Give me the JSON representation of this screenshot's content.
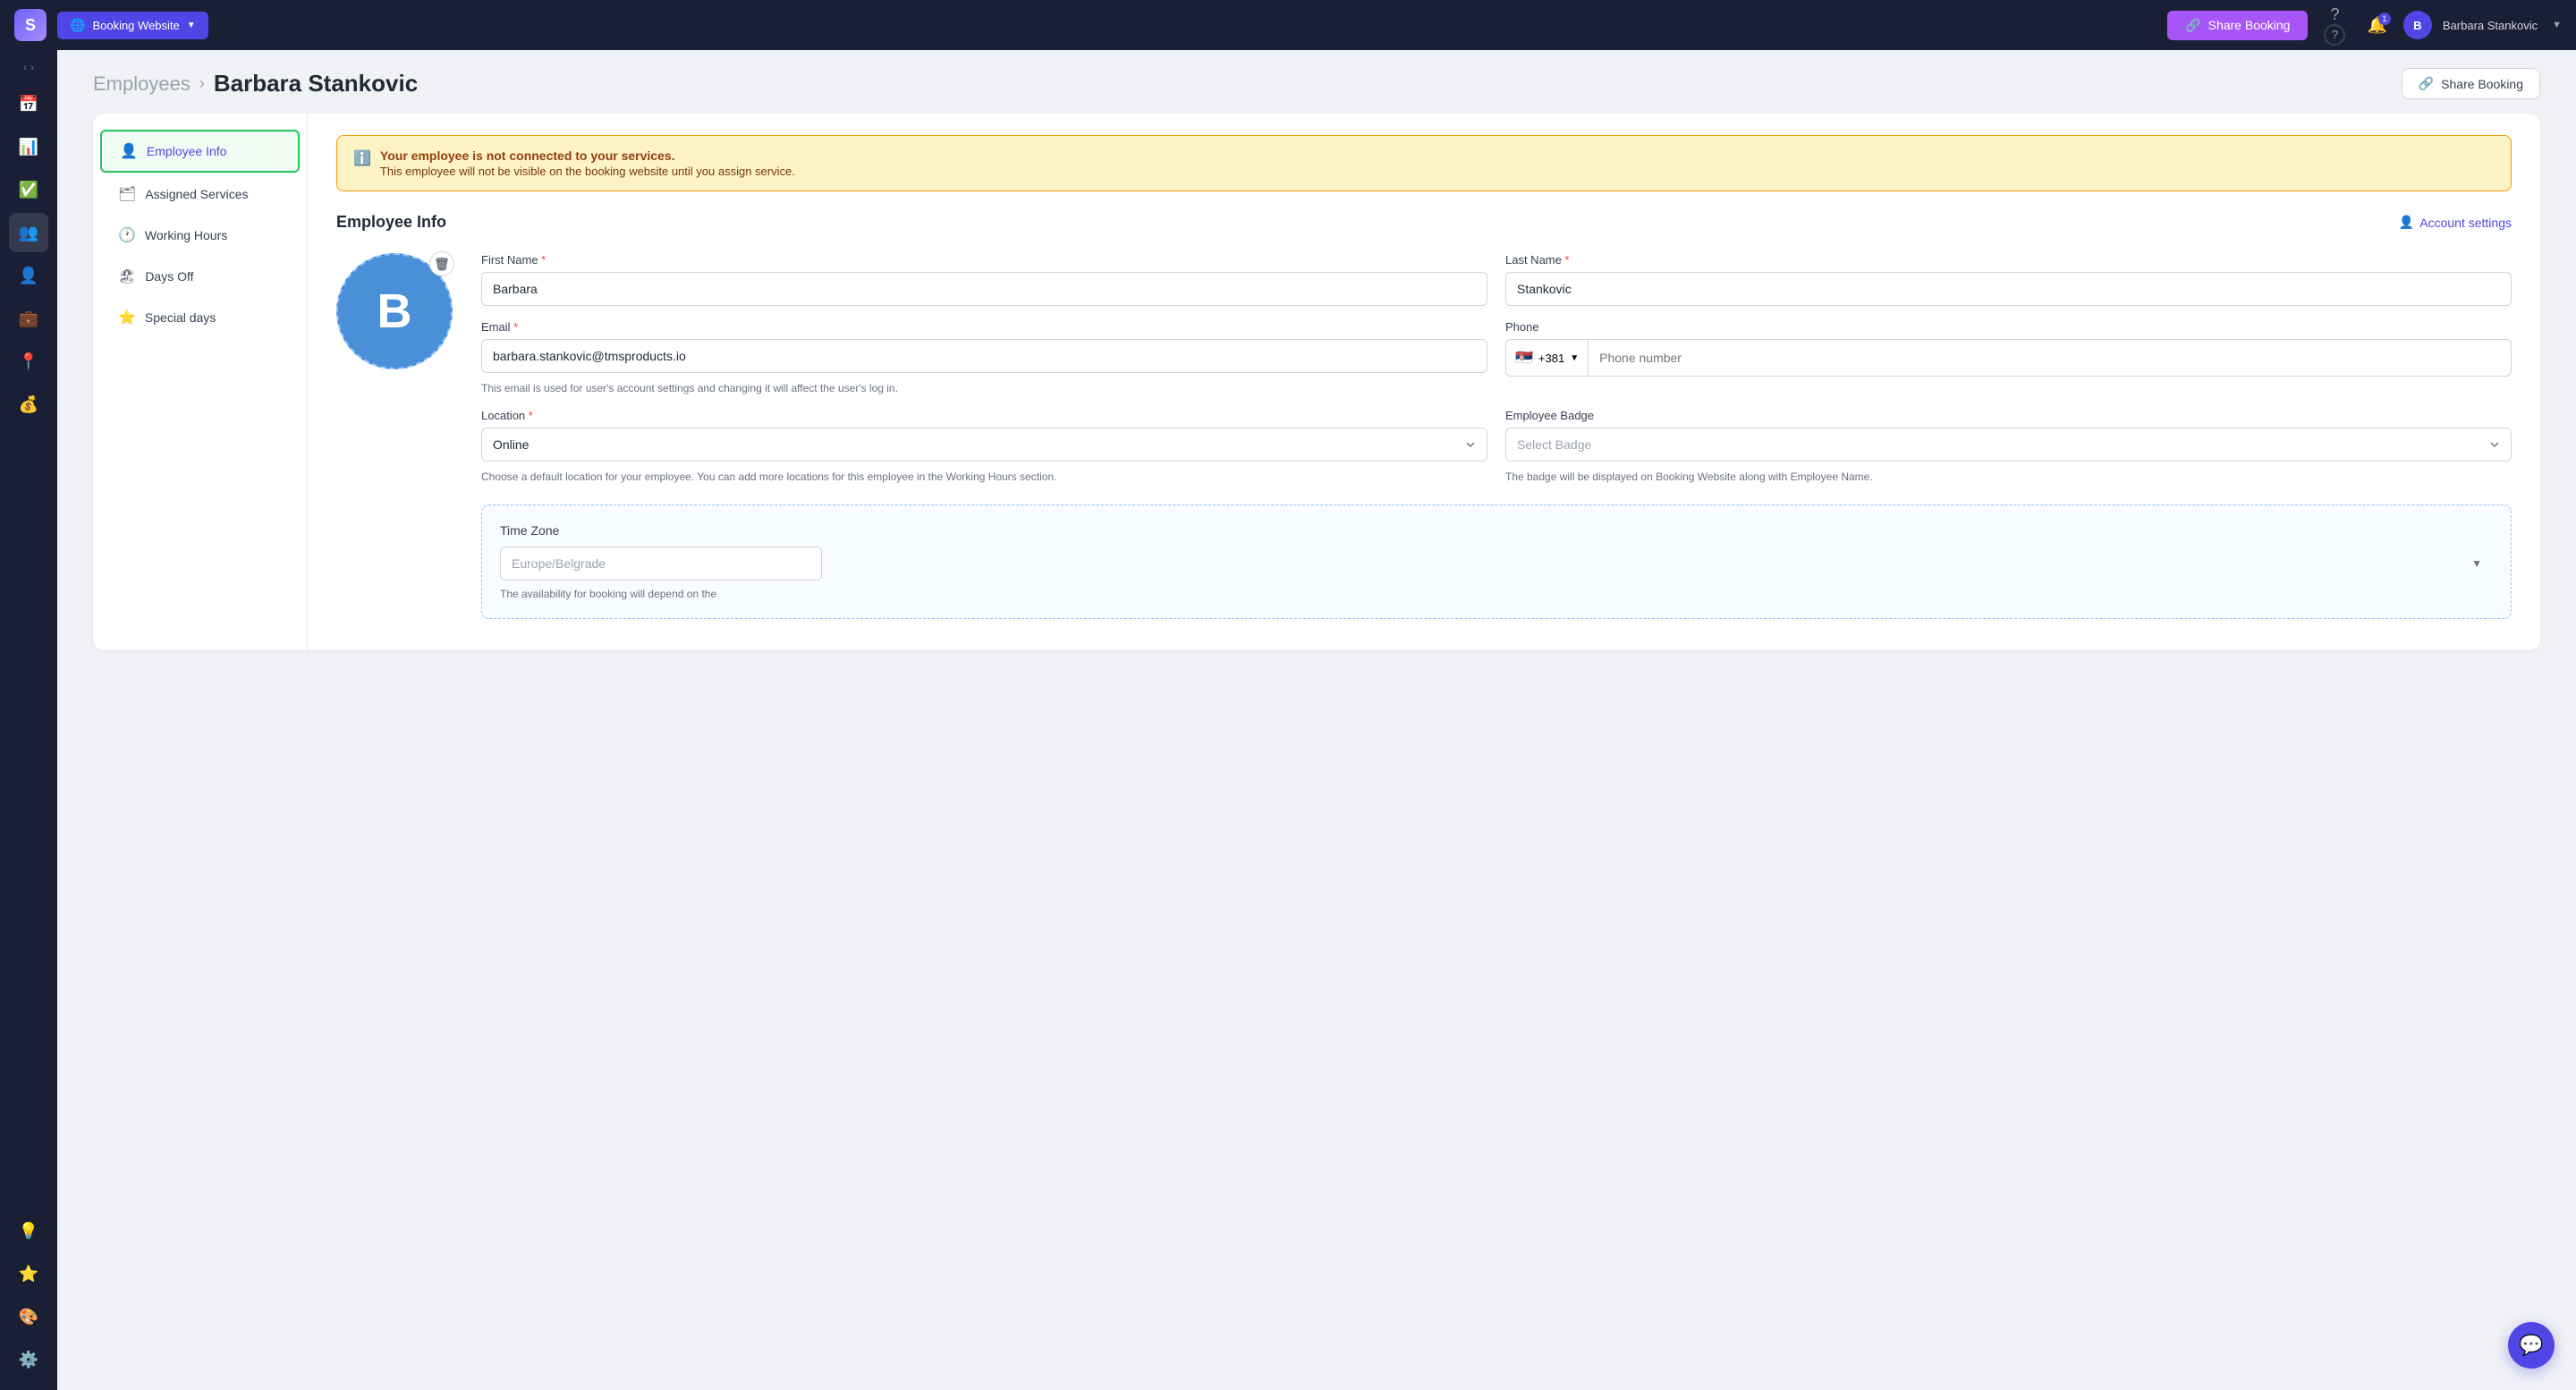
{
  "app": {
    "logo": "S",
    "nav": {
      "booking_website_label": "Booking Website",
      "share_booking_nav": "Share Booking",
      "user_initials": "B",
      "user_name": "Barbara Stankovic",
      "notification_count": "1"
    }
  },
  "breadcrumb": {
    "parent": "Employees",
    "separator": "›",
    "current": "Barbara Stankovic",
    "share_booking": "Share Booking"
  },
  "sidebar_menu": {
    "items": [
      {
        "id": "employee-info",
        "label": "Employee Info",
        "icon": "👤",
        "active": true
      },
      {
        "id": "assigned-services",
        "label": "Assigned Services",
        "icon": "🗂",
        "active": false
      },
      {
        "id": "working-hours",
        "label": "Working Hours",
        "icon": "🕐",
        "active": false
      },
      {
        "id": "days-off",
        "label": "Days Off",
        "icon": "🏖",
        "active": false
      },
      {
        "id": "special-days",
        "label": "Special days",
        "icon": "⭐",
        "active": false
      }
    ]
  },
  "warning": {
    "title": "Your employee is not connected to your services.",
    "subtitle": "This employee will not be visible on the booking website until you assign service."
  },
  "employee_info": {
    "section_title": "Employee Info",
    "account_settings_label": "Account settings",
    "avatar_letter": "B",
    "fields": {
      "first_name_label": "First Name",
      "first_name_value": "Barbara",
      "last_name_label": "Last Name",
      "last_name_value": "Stankovic",
      "email_label": "Email",
      "email_value": "barbara.stankovic@tmsproducts.io",
      "email_hint": "This email is used for user's account settings and changing it will affect the user's log in.",
      "phone_label": "Phone",
      "phone_country_code": "+381",
      "phone_placeholder": "Phone number",
      "location_label": "Location",
      "location_value": "Online",
      "location_hint": "Choose a default location for your employee. You can add more locations for this employee in the Working Hours section.",
      "employee_badge_label": "Employee Badge",
      "employee_badge_placeholder": "Select Badge",
      "employee_badge_hint": "The badge will be displayed on Booking Website along with Employee Name."
    },
    "timezone": {
      "label": "Time Zone",
      "value": "Europe/Belgrade",
      "hint": "The availability for booking will depend on the"
    }
  }
}
